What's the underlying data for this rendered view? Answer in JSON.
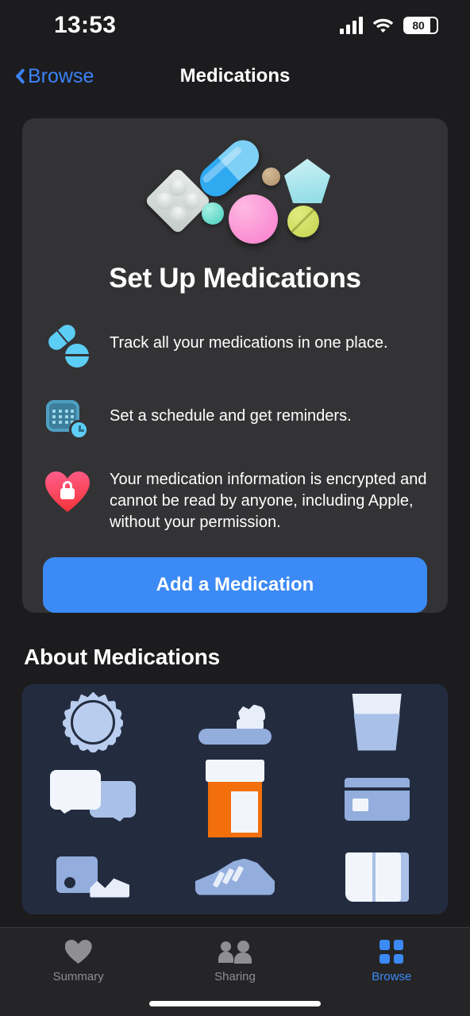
{
  "status_bar": {
    "time": "13:53",
    "battery_percent": "80",
    "battery_level": 80,
    "signal_icon": "cellular-signal-icon",
    "wifi_icon": "wifi-icon"
  },
  "nav": {
    "back_label": "Browse",
    "title": "Medications",
    "accent_color": "#3b82f6"
  },
  "setup_card": {
    "illustration": {
      "name": "medication-pills-illustration",
      "items": [
        {
          "name": "blister-pack",
          "color": "#dfe5e2"
        },
        {
          "name": "blue-capsule",
          "color": "#2fa9f0"
        },
        {
          "name": "tan-round-pill",
          "color": "#c0a075"
        },
        {
          "name": "cyan-pentagon-tablet",
          "color": "#a5e4ee"
        },
        {
          "name": "teal-round-pill",
          "color": "#5fd8c8"
        },
        {
          "name": "pink-round-pill",
          "color": "#f98fd4"
        },
        {
          "name": "yellow-scored-tablet",
          "color": "#d2df62"
        }
      ]
    },
    "title": "Set Up Medications",
    "features": [
      {
        "icon": "pills-icon",
        "text": "Track all your medications in one place."
      },
      {
        "icon": "calendar-clock-icon",
        "text": "Set a schedule and get reminders."
      },
      {
        "icon": "heart-lock-icon",
        "text": "Your medication information is encrypted and cannot be read by anyone, including Apple, without your permission."
      }
    ],
    "button_label": "Add a Medication",
    "button_color": "#3b8af5"
  },
  "about": {
    "section_title": "About Medications",
    "card": {
      "name": "about-medications-banner",
      "background_color": "#232c3f",
      "icons": [
        "sun-icon",
        "toothpaste-icon",
        "water-glass-icon",
        "speech-bubbles-icon",
        "pill-bottle-icon",
        "credit-card-icon",
        "soap-dispenser-icon",
        "sneaker-icon",
        "book-icon"
      ]
    }
  },
  "tab_bar": {
    "tabs": [
      {
        "label": "Summary",
        "icon": "heart-icon",
        "active": false
      },
      {
        "label": "Sharing",
        "icon": "people-icon",
        "active": false
      },
      {
        "label": "Browse",
        "icon": "grid-icon",
        "active": true
      }
    ],
    "active_color": "#3b8af5",
    "inactive_color": "#8e8e93"
  }
}
